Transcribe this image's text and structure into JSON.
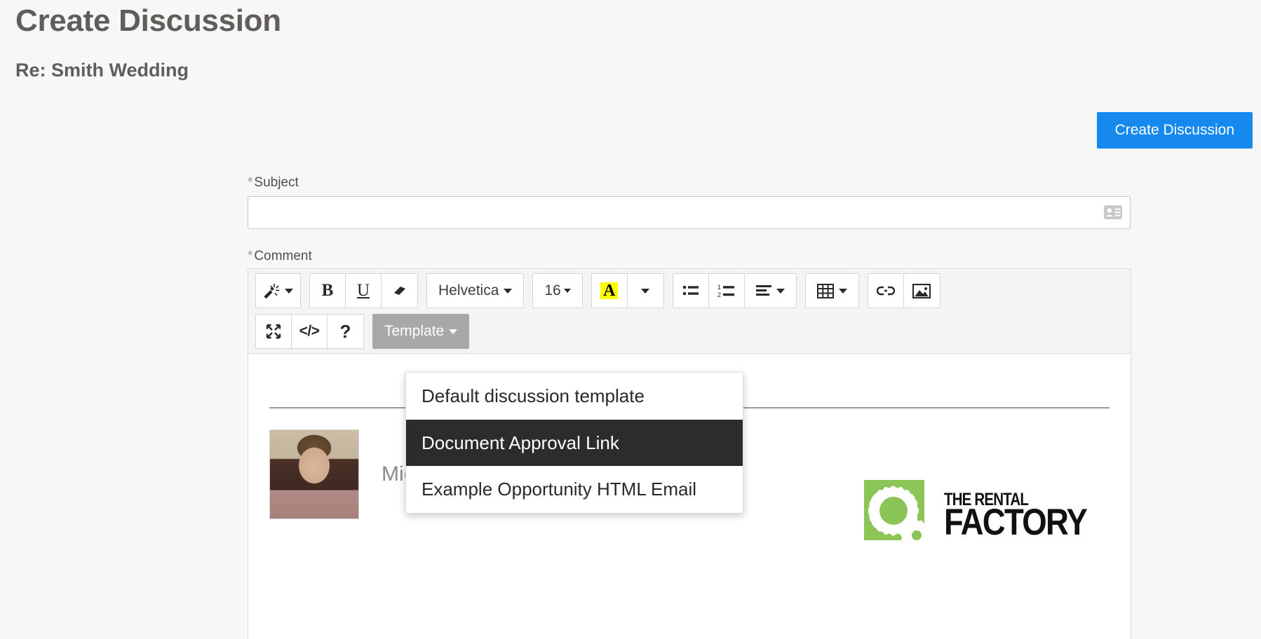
{
  "header": {
    "title": "Create Discussion",
    "subtitle": "Re: Smith Wedding",
    "primary_button": "Create Discussion"
  },
  "form": {
    "required_mark": "*",
    "subject": {
      "label": "Subject",
      "value": "",
      "placeholder": "",
      "icon": "contact-card-icon"
    },
    "comment": {
      "label": "Comment"
    }
  },
  "editor": {
    "toolbar_row1": [
      {
        "name": "format-magic-wand",
        "icon": "magic-wand-icon",
        "label": "",
        "has_caret": true
      },
      {
        "name": "bold",
        "icon": "bold-icon",
        "label": "B",
        "has_caret": false
      },
      {
        "name": "underline",
        "icon": "underline-icon",
        "label": "U",
        "has_caret": false
      },
      {
        "name": "remove-format",
        "icon": "eraser-icon",
        "label": "",
        "has_caret": false
      },
      {
        "name": "font-family",
        "icon": "",
        "label": "Helvetica",
        "has_caret": true
      },
      {
        "name": "font-size",
        "icon": "",
        "label": "16",
        "has_caret": true
      },
      {
        "name": "text-color",
        "icon": "highlight-a-icon",
        "label": "A",
        "has_caret": false
      },
      {
        "name": "text-color-menu",
        "icon": "",
        "label": "",
        "has_caret": true
      },
      {
        "name": "bulleted-list",
        "icon": "bulleted-list-icon",
        "label": "",
        "has_caret": false
      },
      {
        "name": "numbered-list",
        "icon": "numbered-list-icon",
        "label": "",
        "has_caret": false
      },
      {
        "name": "align",
        "icon": "align-left-icon",
        "label": "",
        "has_caret": true
      },
      {
        "name": "table",
        "icon": "table-icon",
        "label": "",
        "has_caret": true
      },
      {
        "name": "link",
        "icon": "link-icon",
        "label": "",
        "has_caret": false
      },
      {
        "name": "image",
        "icon": "image-icon",
        "label": "",
        "has_caret": false
      }
    ],
    "toolbar_row2": [
      {
        "name": "fullscreen",
        "icon": "expand-arrows-icon",
        "label": "",
        "has_caret": false
      },
      {
        "name": "source-code",
        "icon": "code-icon",
        "label": "</>",
        "has_caret": false
      },
      {
        "name": "help",
        "icon": "question-mark-icon",
        "label": "?",
        "has_caret": false
      }
    ],
    "template_button": {
      "label": "Template",
      "active": true
    },
    "template_menu": {
      "items": [
        {
          "label": "Default discussion template",
          "selected": false
        },
        {
          "label": "Document Approval Link",
          "selected": true
        },
        {
          "label": "Example Opportunity HTML Email",
          "selected": false
        }
      ]
    },
    "content": {
      "signature_name": "Mic",
      "photo_alt": "profile-photo",
      "logo": {
        "line1": "THE RENTAL",
        "line2": "FACTORY",
        "color": "#8cc557"
      }
    }
  },
  "colors": {
    "accent_blue": "#1589ee",
    "page_background": "#f7f7f7",
    "menu_selected": "#2e2c2b",
    "toolbar_active": "#a8a8a8",
    "brand_green": "#8cc557",
    "highlight_yellow": "#ffff00"
  }
}
